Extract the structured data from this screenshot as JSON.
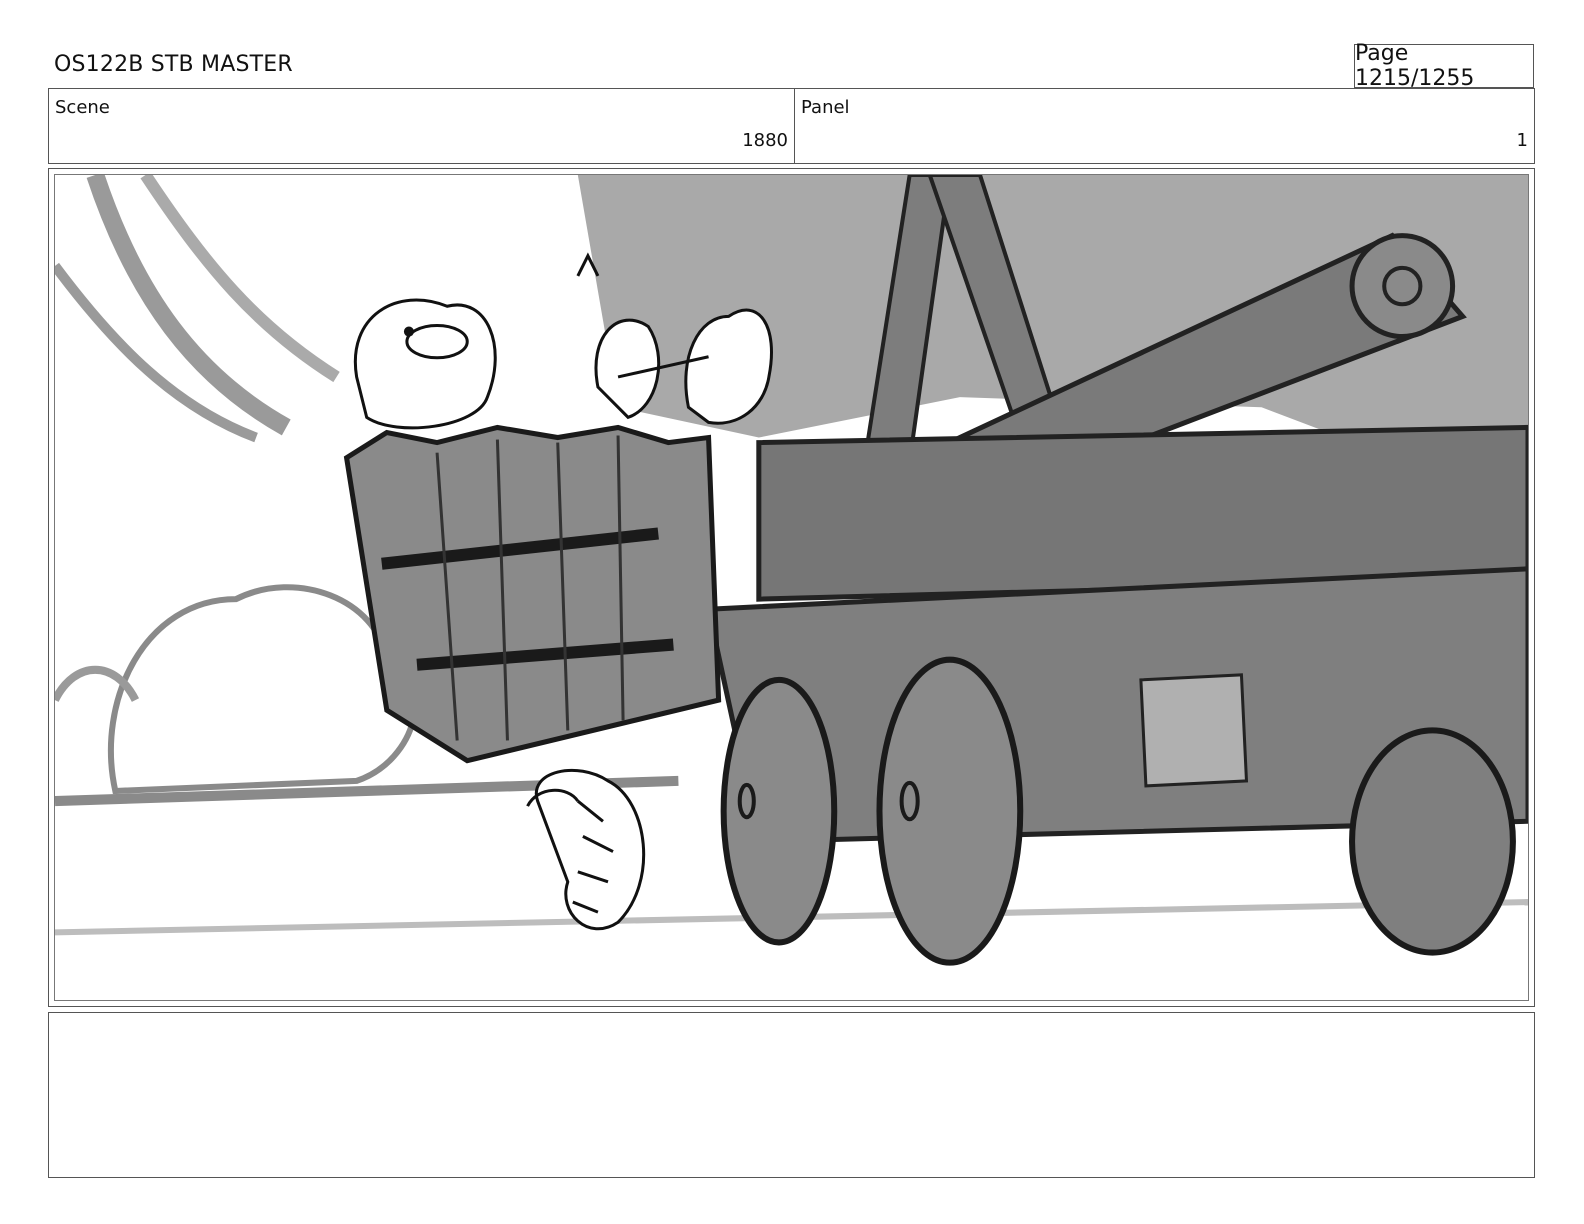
{
  "header": {
    "title": "OS122B STB MASTER",
    "page": "Page 1215/1255"
  },
  "scene": {
    "label": "Scene",
    "value": "1880"
  },
  "panel": {
    "label": "Panel",
    "value": "1"
  },
  "notes": {
    "text": ""
  },
  "colors": {
    "sketch_dark": "#757575",
    "sketch_mid": "#9a9a9a",
    "sketch_light": "#b3b3b3",
    "ink": "#1a1a1a"
  }
}
